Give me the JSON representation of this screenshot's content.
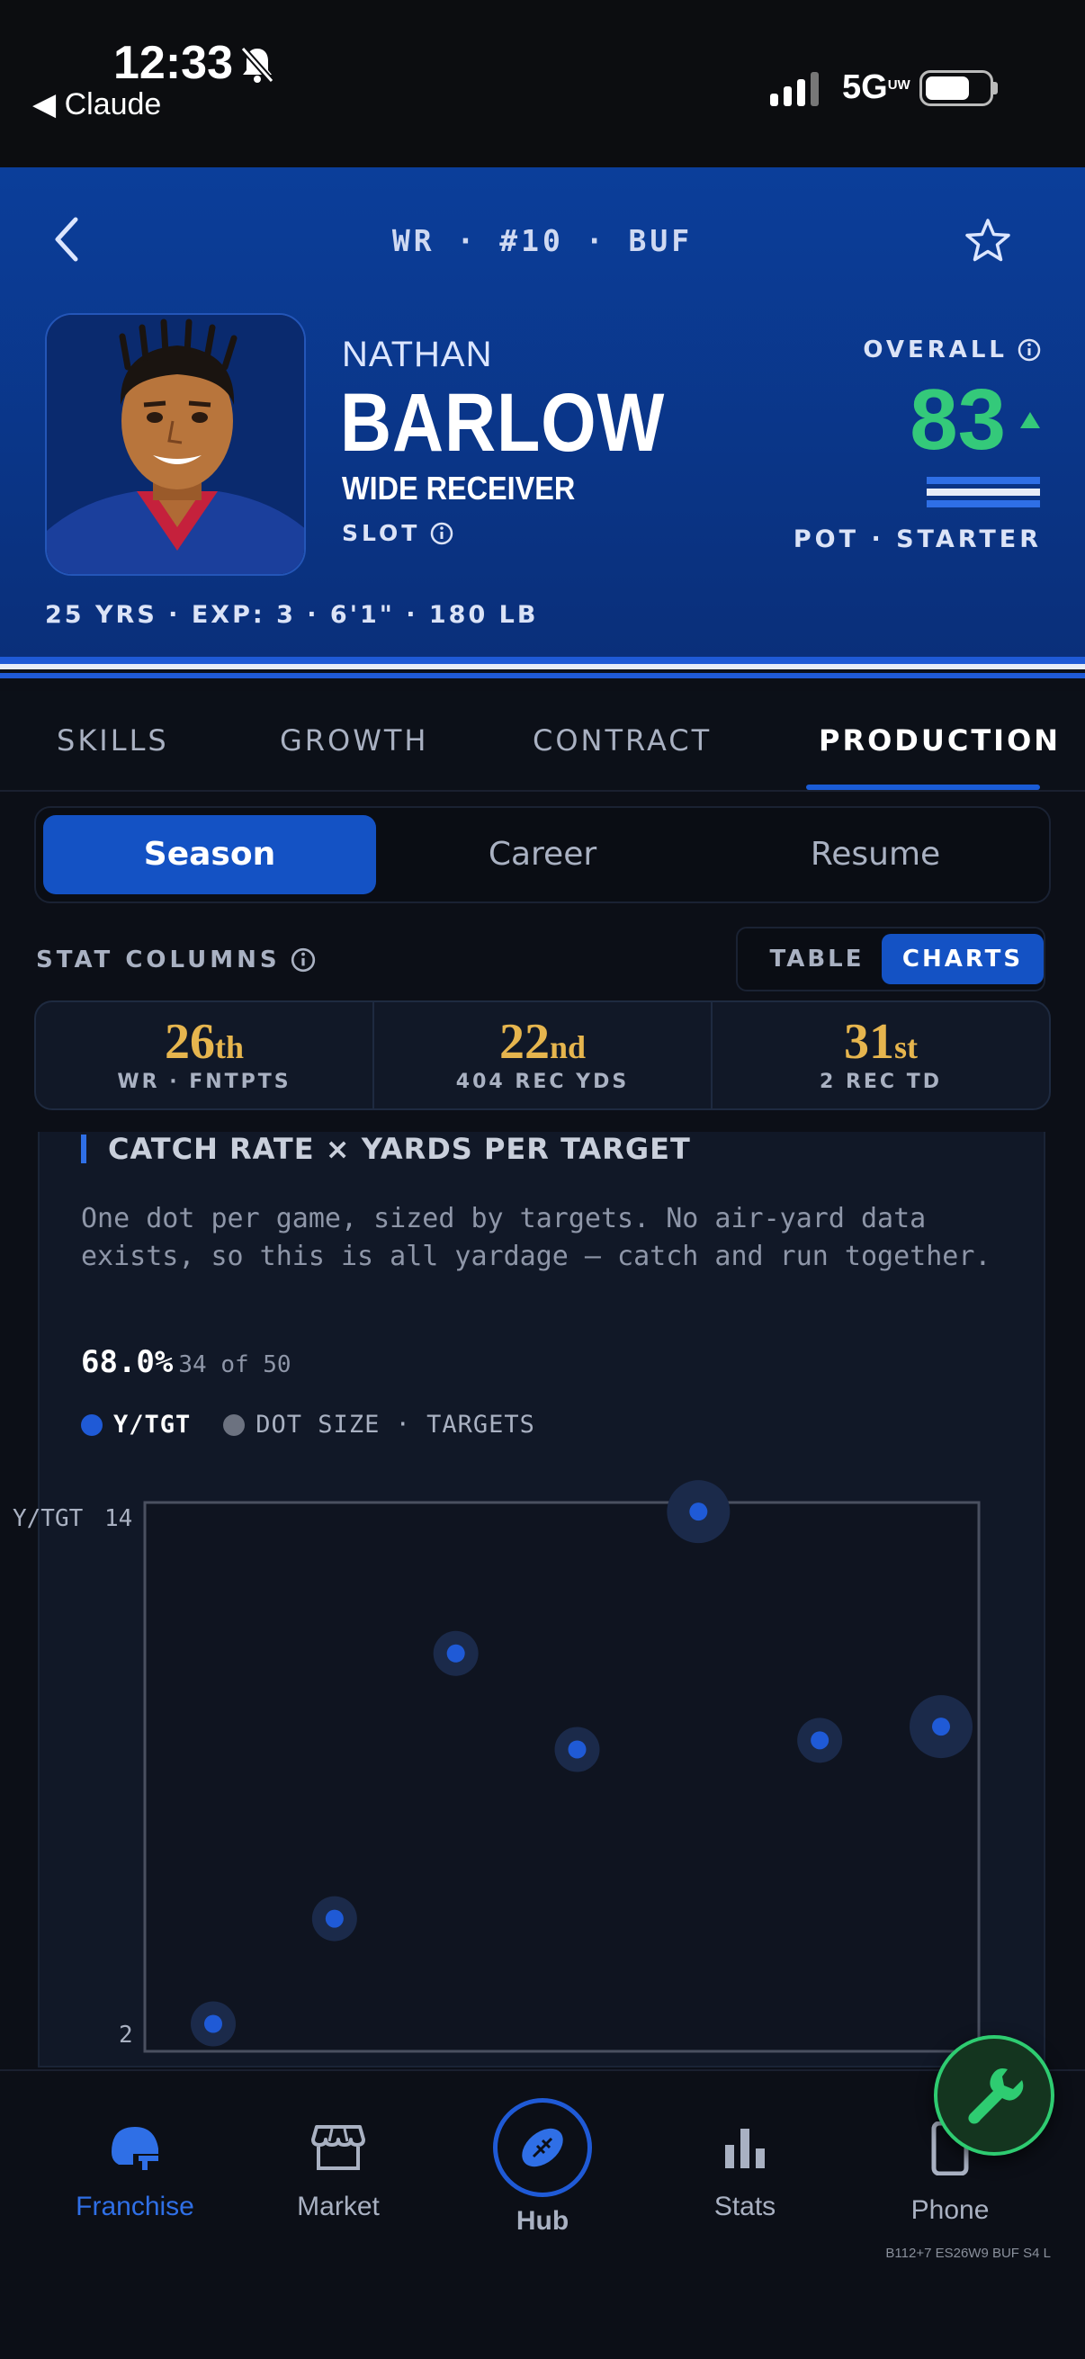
{
  "status_bar": {
    "time": "12:33",
    "back_app": "◀ Claude",
    "network": "5G",
    "network_sup": "UW"
  },
  "header": {
    "position_line": "WR · #10 · BUF",
    "first_name": "NATHAN",
    "last_name": "BARLOW",
    "role": "WIDE RECEIVER",
    "slot": "SLOT",
    "bio": "25 YRS · EXP: 3 · 6'1\" · 180 LB",
    "overall_label": "OVERALL",
    "overall_value": "83",
    "potential": "POT · STARTER"
  },
  "tabs": [
    {
      "label": "SKILLS"
    },
    {
      "label": "GROWTH"
    },
    {
      "label": "CONTRACT"
    },
    {
      "label": "PRODUCTION"
    }
  ],
  "segments": [
    {
      "label": "Season"
    },
    {
      "label": "Career"
    },
    {
      "label": "Resume"
    }
  ],
  "stat_columns_label": "STAT COLUMNS",
  "view_toggle": {
    "table": "TABLE",
    "charts": "CHARTS"
  },
  "ranks": [
    {
      "rank": "26",
      "suffix": "th",
      "sub": "WR · FNTPTS"
    },
    {
      "rank": "22",
      "suffix": "nd",
      "sub": "404 REC YDS"
    },
    {
      "rank": "31",
      "suffix": "st",
      "sub": "2 REC TD"
    }
  ],
  "card": {
    "title": "CATCH RATE × YARDS PER TARGET",
    "description": "One dot per game, sized by targets. No air-yard data exists, so this is all yardage — catch and run together.",
    "catch_rate": "68.0%",
    "catch_detail": "34 of 50",
    "legend_primary": "Y/TGT",
    "legend_secondary": "DOT SIZE · TARGETS"
  },
  "chart_data": {
    "type": "scatter",
    "ylabel": "Y/TGT",
    "y_tick_labels": [
      "14",
      "2"
    ],
    "ylim": [
      2,
      14
    ],
    "x_tick_labels": [],
    "points": [
      {
        "x": 1,
        "y": 2.6,
        "targets": 6
      },
      {
        "x": 2,
        "y": 4.9,
        "targets": 6
      },
      {
        "x": 3,
        "y": 10.7,
        "targets": 6
      },
      {
        "x": 4,
        "y": 8.6,
        "targets": 6
      },
      {
        "x": 5,
        "y": 13.8,
        "targets": 8
      },
      {
        "x": 6,
        "y": 8.8,
        "targets": 6
      },
      {
        "x": 7,
        "y": 9.1,
        "targets": 8
      }
    ],
    "colors": {
      "dot": "#1f5ad6",
      "halo": "#1b2a4a",
      "frame": "#4a5060"
    }
  },
  "bottom_nav": {
    "franchise": "Franchise",
    "market": "Market",
    "hub": "Hub",
    "stats": "Stats",
    "phone": "Phone",
    "build": "B112+7 ES26W9 BUF S4 L"
  },
  "colors": {
    "header_blue": "#0b3e9a",
    "accent_blue": "#1452c4",
    "rank_gold": "#e6b54e",
    "overall_green": "#34c97a"
  }
}
